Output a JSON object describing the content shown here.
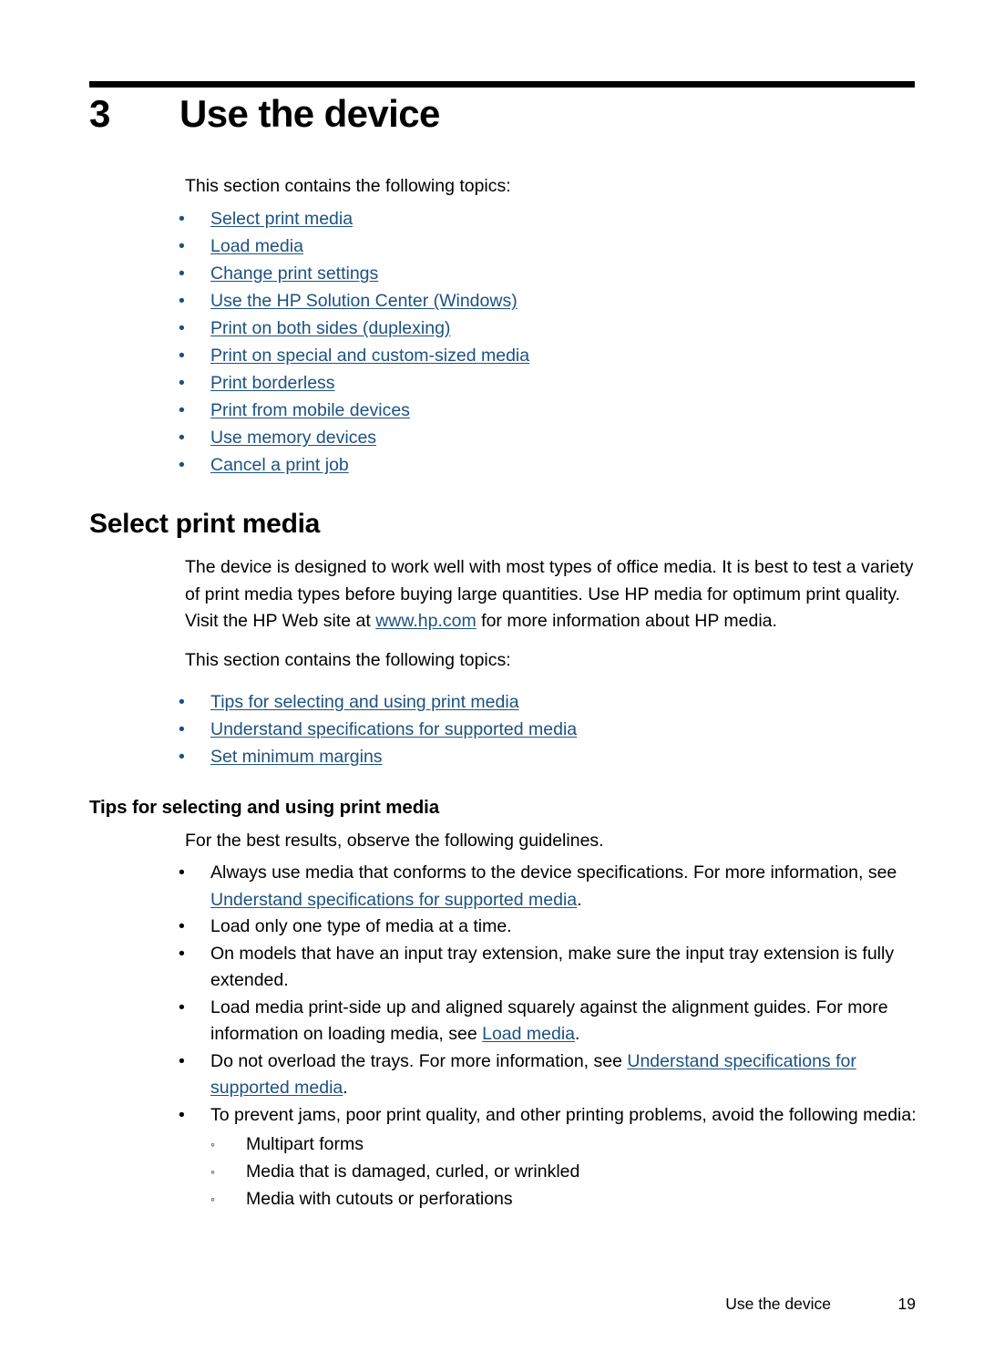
{
  "chapter": {
    "number": "3",
    "title": "Use the device"
  },
  "intro": {
    "text": "This section contains the following topics:"
  },
  "topic_links": [
    {
      "label": "Select print media"
    },
    {
      "label": "Load media"
    },
    {
      "label": "Change print settings"
    },
    {
      "label": "Use the HP Solution Center (Windows)"
    },
    {
      "label": "Print on both sides (duplexing)"
    },
    {
      "label": "Print on special and custom-sized media"
    },
    {
      "label": "Print borderless"
    },
    {
      "label": "Print from mobile devices"
    },
    {
      "label": "Use memory devices"
    },
    {
      "label": "Cancel a print job"
    }
  ],
  "section": {
    "heading": "Select print media",
    "para_part1": "The device is designed to work well with most types of office media. It is best to test a variety of print media types before buying large quantities. Use HP media for optimum print quality. Visit the HP Web site at ",
    "para_link": "www.hp.com",
    "para_part2": " for more information about HP media.",
    "topics_intro": "This section contains the following topics:",
    "topic_links": [
      {
        "label": "Tips for selecting and using print media"
      },
      {
        "label": "Understand specifications for supported media"
      },
      {
        "label": "Set minimum margins"
      }
    ]
  },
  "tips": {
    "heading": "Tips for selecting and using print media",
    "intro": "For the best results, observe the following guidelines.",
    "bullets": [
      {
        "part1": "Always use media that conforms to the device specifications. For more information, see ",
        "link": "Understand specifications for supported media",
        "part2": "."
      },
      {
        "part1": "Load only one type of media at a time.",
        "link": "",
        "part2": ""
      },
      {
        "part1": "On models that have an input tray extension, make sure the input tray extension is fully extended.",
        "link": "",
        "part2": ""
      },
      {
        "part1": "Load media print-side up and aligned squarely against the alignment guides. For more information on loading media, see ",
        "link": "Load media",
        "part2": "."
      },
      {
        "part1": "Do not overload the trays. For more information, see ",
        "link": "Understand specifications for supported media",
        "part2": "."
      },
      {
        "part1": "To prevent jams, poor print quality, and other printing problems, avoid the following media:",
        "link": "",
        "part2": ""
      }
    ],
    "sub_bullets": [
      {
        "label": "Multipart forms"
      },
      {
        "label": "Media that is damaged, curled, or wrinkled"
      },
      {
        "label": "Media with cutouts or perforations"
      }
    ]
  },
  "footer": {
    "label": "Use the device",
    "page": "19"
  },
  "icons": {
    "bullet": "•",
    "sub_bullet": "◦"
  },
  "colors": {
    "link": "#1c5181",
    "text": "#000000",
    "background": "#ffffff"
  }
}
